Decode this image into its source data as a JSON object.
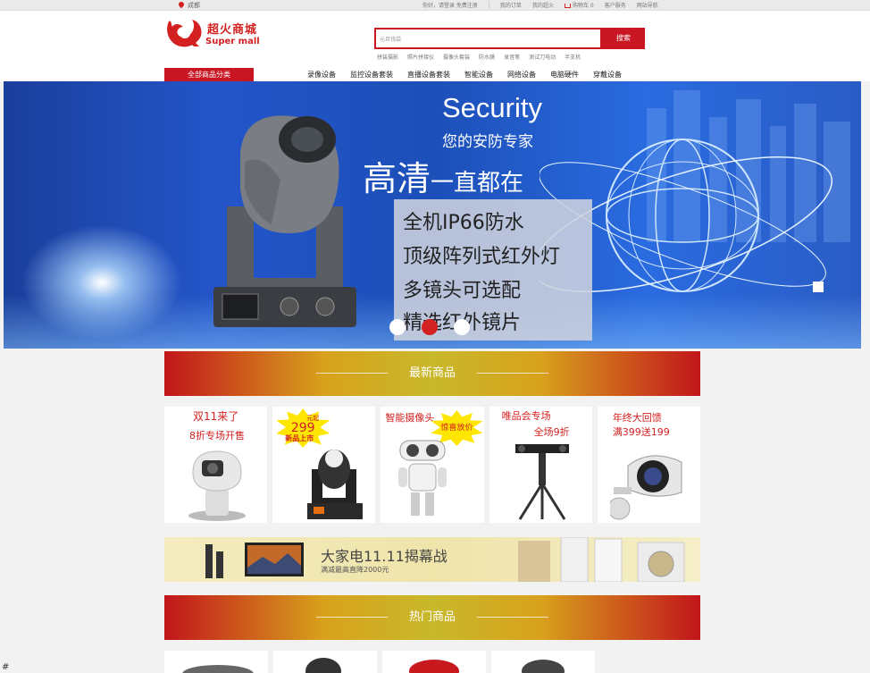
{
  "topbar": {
    "location": "成都",
    "links": [
      "你好，请登录 免费注册",
      "我的订单",
      "我的超火",
      "购物车 0",
      "客户服务",
      "网站导航"
    ]
  },
  "header": {
    "logo_cn": "超火商城",
    "logo_en": "Super mall",
    "search_placeholder": "元旦钱袋",
    "search_button": "搜索",
    "hot_words": [
      "拼装摄影",
      "照片拼接仪",
      "摄像头套装",
      "防水膜",
      "录音笔",
      "测试刀电动",
      "半支机"
    ]
  },
  "nav": {
    "all_categories": "全部商品分类",
    "items": [
      "录像设备",
      "监控设备套装",
      "直播设备套装",
      "智能设备",
      "网络设备",
      "电脑硬件",
      "穿戴设备"
    ]
  },
  "banner": {
    "title": "Security",
    "subtitle": "您的安防专家",
    "headline_big": "高清",
    "headline_small": "一直都在",
    "features": [
      "全机IP66防水",
      "顶级阵列式红外灯",
      "多镜头可选配",
      "精选红外镜片"
    ],
    "dots": 3,
    "active_dot": 1
  },
  "sections": {
    "new": "最新商品",
    "hot": "热门商品"
  },
  "products": [
    {
      "line1": "双11来了",
      "line2": "8折专场开售"
    },
    {
      "line1": "299",
      "line2": "新品上市",
      "tag": "元起"
    },
    {
      "line1": "智能摄像头",
      "line2": "惊喜放价"
    },
    {
      "line1": "唯品会专场",
      "line2": "全场9折"
    },
    {
      "line1": "年终大回馈",
      "line2": "满399送199"
    }
  ],
  "appliance_banner": {
    "title": "大家电11.11揭幕战",
    "subtitle": "满减最高直降2000元"
  },
  "footer_mark": "#",
  "colors": {
    "brand_red": "#c81623",
    "banner_blue": "#2455c9"
  }
}
